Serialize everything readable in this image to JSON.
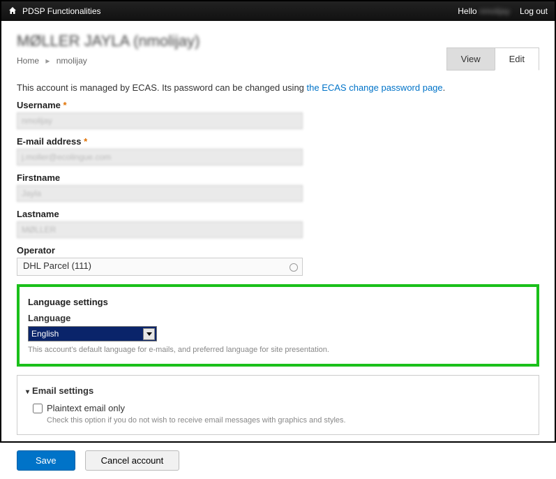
{
  "topbar": {
    "app": "PDSP Functionalities",
    "hello": "Hello",
    "user": "nmolijay",
    "logout": "Log out"
  },
  "page_title": "MØLLER JAYLA (nmolijay)",
  "crumbs": {
    "home": "Home",
    "current": "nmolijay"
  },
  "tabs": {
    "view": "View",
    "edit": "Edit"
  },
  "intro": {
    "pre": "This account is managed by ECAS. Its password can be changed using ",
    "link": "the ECAS change password page",
    "post": "."
  },
  "fields": {
    "username": {
      "label": "Username",
      "value": "nmolijay"
    },
    "email": {
      "label": "E-mail address",
      "value": "j.moller@ecolingue.com"
    },
    "firstname": {
      "label": "Firstname",
      "value": "Jayla"
    },
    "lastname": {
      "label": "Lastname",
      "value": "MØLLER"
    },
    "operator": {
      "label": "Operator",
      "value": "DHL Parcel (111)"
    }
  },
  "lang": {
    "section": "Language settings",
    "label": "Language",
    "value": "English",
    "help": "This account's default language for e-mails, and preferred language for site presentation."
  },
  "emailset": {
    "section": "Email settings",
    "chk": "Plaintext email only",
    "help": "Check this option if you do not wish to receive email messages with graphics and styles."
  },
  "actions": {
    "save": "Save",
    "cancel": "Cancel account"
  }
}
